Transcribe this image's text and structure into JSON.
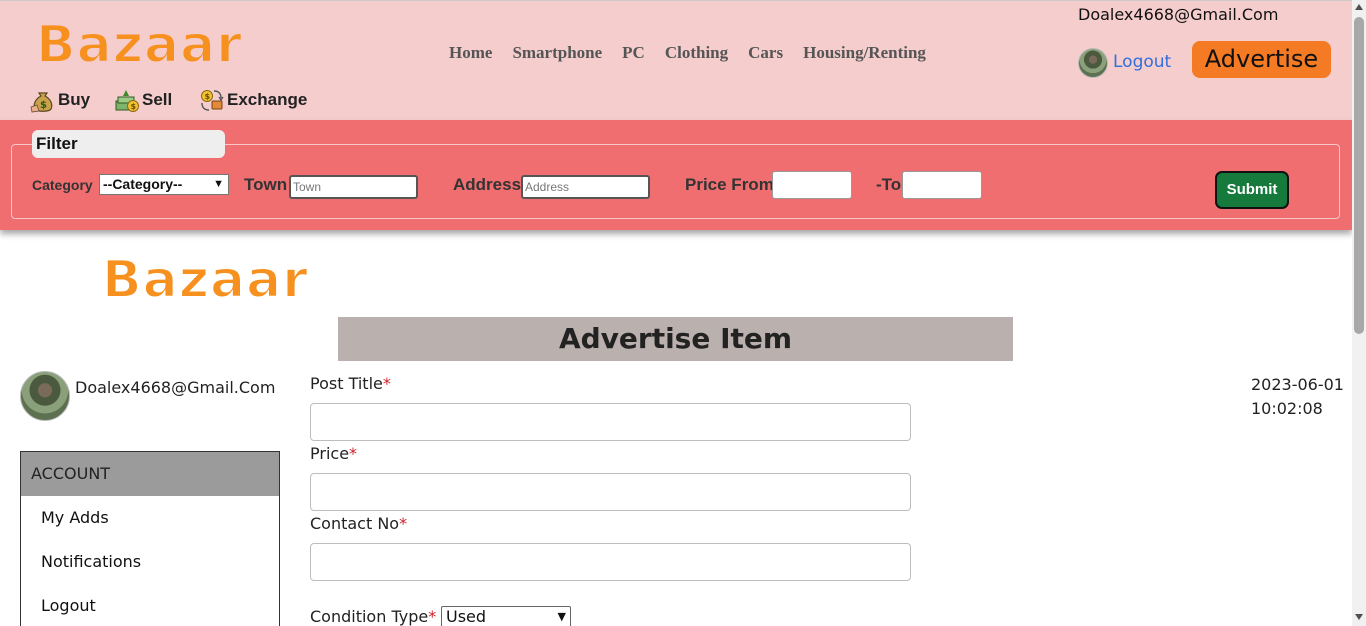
{
  "app": {
    "brand": "Bazaar",
    "accent_color": "#f6901e",
    "header_bg": "#f5cdcd",
    "filter_bg": "#f16e70"
  },
  "header": {
    "user_email": "Doalex4668@Gmail.Com",
    "nav": [
      "Home",
      "Smartphone",
      "PC",
      "Clothing",
      "Cars",
      "Housing/Renting"
    ],
    "logout_label": "Logout",
    "advertise_label": "Advertise",
    "actions": [
      {
        "label": "Buy",
        "icon": "money-bag-icon"
      },
      {
        "label": "Sell",
        "icon": "money-stack-icon"
      },
      {
        "label": "Exchange",
        "icon": "exchange-icon"
      }
    ]
  },
  "filter": {
    "legend": "Filter",
    "category_label": "Category",
    "category_value": "--Category--",
    "town_label": "Town",
    "town_placeholder": "Town",
    "address_label": "Address",
    "address_placeholder": "Address",
    "price_from_label": "Price From",
    "price_to_label": "-To",
    "submit_label": "Submit"
  },
  "main": {
    "title": "Advertise Item",
    "user_email": "Doalex4668@Gmail.Com",
    "date": "2023-06-01",
    "time": "10:02:08"
  },
  "account_menu": {
    "heading": "ACCOUNT",
    "items": [
      "My Adds",
      "Notifications",
      "Logout"
    ]
  },
  "form": {
    "post_title_label": "Post Title",
    "price_label": "Price",
    "contact_label": "Contact No",
    "condition_label": "Condition Type",
    "required_mark": "*",
    "condition_value": "Used"
  }
}
